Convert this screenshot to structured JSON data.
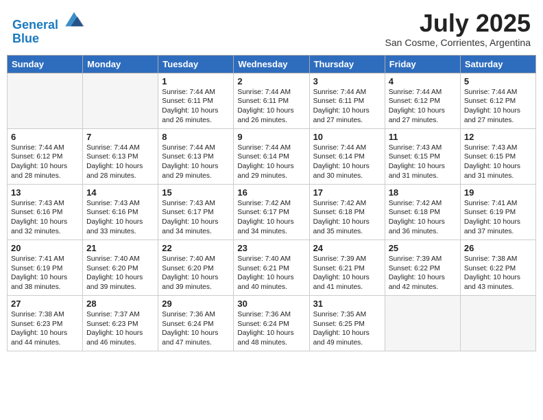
{
  "header": {
    "logo_line1": "General",
    "logo_line2": "Blue",
    "month": "July 2025",
    "location": "San Cosme, Corrientes, Argentina"
  },
  "days_of_week": [
    "Sunday",
    "Monday",
    "Tuesday",
    "Wednesday",
    "Thursday",
    "Friday",
    "Saturday"
  ],
  "weeks": [
    [
      {
        "day": "",
        "info": ""
      },
      {
        "day": "",
        "info": ""
      },
      {
        "day": "1",
        "info": "Sunrise: 7:44 AM\nSunset: 6:11 PM\nDaylight: 10 hours and 26 minutes."
      },
      {
        "day": "2",
        "info": "Sunrise: 7:44 AM\nSunset: 6:11 PM\nDaylight: 10 hours and 26 minutes."
      },
      {
        "day": "3",
        "info": "Sunrise: 7:44 AM\nSunset: 6:11 PM\nDaylight: 10 hours and 27 minutes."
      },
      {
        "day": "4",
        "info": "Sunrise: 7:44 AM\nSunset: 6:12 PM\nDaylight: 10 hours and 27 minutes."
      },
      {
        "day": "5",
        "info": "Sunrise: 7:44 AM\nSunset: 6:12 PM\nDaylight: 10 hours and 27 minutes."
      }
    ],
    [
      {
        "day": "6",
        "info": "Sunrise: 7:44 AM\nSunset: 6:12 PM\nDaylight: 10 hours and 28 minutes."
      },
      {
        "day": "7",
        "info": "Sunrise: 7:44 AM\nSunset: 6:13 PM\nDaylight: 10 hours and 28 minutes."
      },
      {
        "day": "8",
        "info": "Sunrise: 7:44 AM\nSunset: 6:13 PM\nDaylight: 10 hours and 29 minutes."
      },
      {
        "day": "9",
        "info": "Sunrise: 7:44 AM\nSunset: 6:14 PM\nDaylight: 10 hours and 29 minutes."
      },
      {
        "day": "10",
        "info": "Sunrise: 7:44 AM\nSunset: 6:14 PM\nDaylight: 10 hours and 30 minutes."
      },
      {
        "day": "11",
        "info": "Sunrise: 7:43 AM\nSunset: 6:15 PM\nDaylight: 10 hours and 31 minutes."
      },
      {
        "day": "12",
        "info": "Sunrise: 7:43 AM\nSunset: 6:15 PM\nDaylight: 10 hours and 31 minutes."
      }
    ],
    [
      {
        "day": "13",
        "info": "Sunrise: 7:43 AM\nSunset: 6:16 PM\nDaylight: 10 hours and 32 minutes."
      },
      {
        "day": "14",
        "info": "Sunrise: 7:43 AM\nSunset: 6:16 PM\nDaylight: 10 hours and 33 minutes."
      },
      {
        "day": "15",
        "info": "Sunrise: 7:43 AM\nSunset: 6:17 PM\nDaylight: 10 hours and 34 minutes."
      },
      {
        "day": "16",
        "info": "Sunrise: 7:42 AM\nSunset: 6:17 PM\nDaylight: 10 hours and 34 minutes."
      },
      {
        "day": "17",
        "info": "Sunrise: 7:42 AM\nSunset: 6:18 PM\nDaylight: 10 hours and 35 minutes."
      },
      {
        "day": "18",
        "info": "Sunrise: 7:42 AM\nSunset: 6:18 PM\nDaylight: 10 hours and 36 minutes."
      },
      {
        "day": "19",
        "info": "Sunrise: 7:41 AM\nSunset: 6:19 PM\nDaylight: 10 hours and 37 minutes."
      }
    ],
    [
      {
        "day": "20",
        "info": "Sunrise: 7:41 AM\nSunset: 6:19 PM\nDaylight: 10 hours and 38 minutes."
      },
      {
        "day": "21",
        "info": "Sunrise: 7:40 AM\nSunset: 6:20 PM\nDaylight: 10 hours and 39 minutes."
      },
      {
        "day": "22",
        "info": "Sunrise: 7:40 AM\nSunset: 6:20 PM\nDaylight: 10 hours and 39 minutes."
      },
      {
        "day": "23",
        "info": "Sunrise: 7:40 AM\nSunset: 6:21 PM\nDaylight: 10 hours and 40 minutes."
      },
      {
        "day": "24",
        "info": "Sunrise: 7:39 AM\nSunset: 6:21 PM\nDaylight: 10 hours and 41 minutes."
      },
      {
        "day": "25",
        "info": "Sunrise: 7:39 AM\nSunset: 6:22 PM\nDaylight: 10 hours and 42 minutes."
      },
      {
        "day": "26",
        "info": "Sunrise: 7:38 AM\nSunset: 6:22 PM\nDaylight: 10 hours and 43 minutes."
      }
    ],
    [
      {
        "day": "27",
        "info": "Sunrise: 7:38 AM\nSunset: 6:23 PM\nDaylight: 10 hours and 44 minutes."
      },
      {
        "day": "28",
        "info": "Sunrise: 7:37 AM\nSunset: 6:23 PM\nDaylight: 10 hours and 46 minutes."
      },
      {
        "day": "29",
        "info": "Sunrise: 7:36 AM\nSunset: 6:24 PM\nDaylight: 10 hours and 47 minutes."
      },
      {
        "day": "30",
        "info": "Sunrise: 7:36 AM\nSunset: 6:24 PM\nDaylight: 10 hours and 48 minutes."
      },
      {
        "day": "31",
        "info": "Sunrise: 7:35 AM\nSunset: 6:25 PM\nDaylight: 10 hours and 49 minutes."
      },
      {
        "day": "",
        "info": ""
      },
      {
        "day": "",
        "info": ""
      }
    ]
  ]
}
